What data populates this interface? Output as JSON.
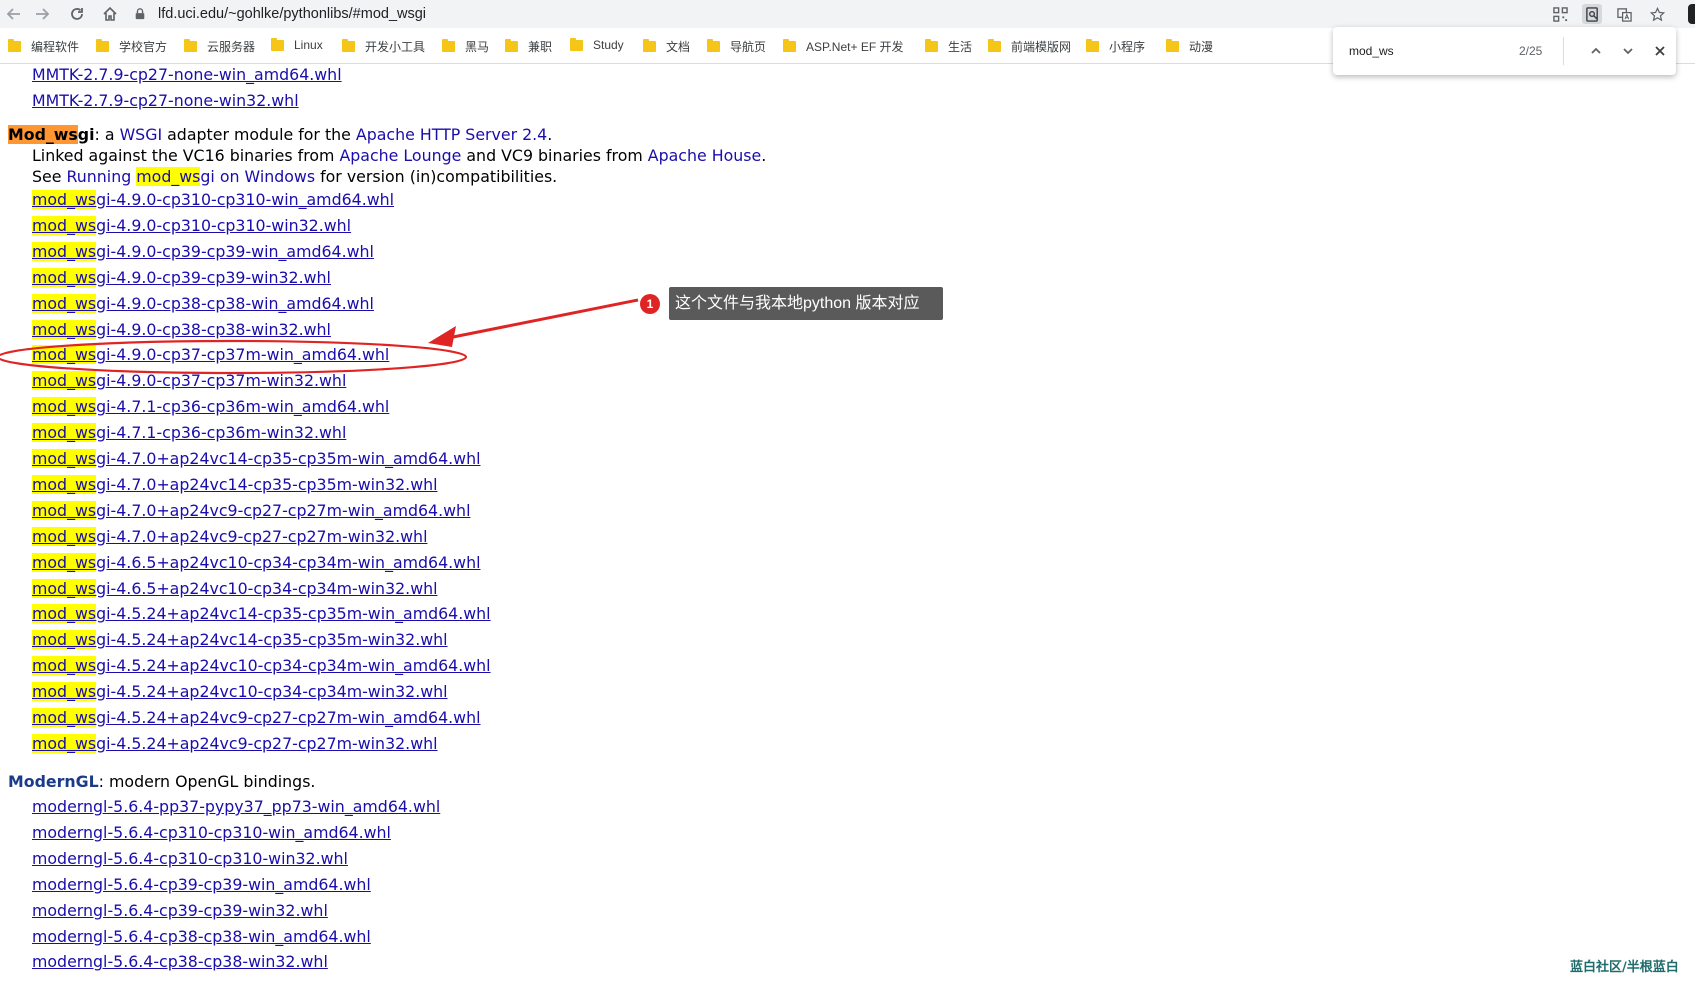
{
  "browser": {
    "url": "lfd.uci.edu/~gohlke/pythonlibs/#mod_wsgi",
    "bookmarks": [
      "编程软件",
      "学校官方",
      "云服务器",
      "Linux",
      "开发小工具",
      "黑马",
      "兼职",
      "Study",
      "文档",
      "导航页",
      "ASP.Net+ EF 开发",
      "生活",
      "前端模版网",
      "小程序",
      "动漫"
    ]
  },
  "find": {
    "query": "mod_ws",
    "count": "2/25"
  },
  "mmtk_links": [
    "MMTK-2.7.9-cp27-none-win_amd64.whl",
    "MMTK-2.7.9-cp27-none-win32.whl"
  ],
  "modwsgi": {
    "name_hl": "Mod_ws",
    "name_rest": "gi",
    "desc_a": ": a ",
    "desc_wsgi": "WSGI",
    "desc_b": " adapter module for the ",
    "desc_apache": "Apache HTTP Server 2.4",
    "desc_c": ".",
    "line2_a": "Linked against the VC16 binaries from ",
    "line2_lounge": "Apache Lounge",
    "line2_b": " and VC9 binaries from ",
    "line2_house": "Apache House",
    "line2_c": ".",
    "line3_a": "See ",
    "line3_running": "Running ",
    "line3_hl": "mod_ws",
    "line3_rest": "gi on Windows",
    "line3_b": " for version (in)compatibilities.",
    "hl_prefix": "mod_ws",
    "files": [
      "gi-4.9.0-cp310-cp310-win_amd64.whl",
      "gi-4.9.0-cp310-cp310-win32.whl",
      "gi-4.9.0-cp39-cp39-win_amd64.whl",
      "gi-4.9.0-cp39-cp39-win32.whl",
      "gi-4.9.0-cp38-cp38-win_amd64.whl",
      "gi-4.9.0-cp38-cp38-win32.whl",
      "gi-4.9.0-cp37-cp37m-win_amd64.whl",
      "gi-4.9.0-cp37-cp37m-win32.whl",
      "gi-4.7.1-cp36-cp36m-win_amd64.whl",
      "gi-4.7.1-cp36-cp36m-win32.whl",
      "gi-4.7.0+ap24vc14-cp35-cp35m-win_amd64.whl",
      "gi-4.7.0+ap24vc14-cp35-cp35m-win32.whl",
      "gi-4.7.0+ap24vc9-cp27-cp27m-win_amd64.whl",
      "gi-4.7.0+ap24vc9-cp27-cp27m-win32.whl",
      "gi-4.6.5+ap24vc10-cp34-cp34m-win_amd64.whl",
      "gi-4.6.5+ap24vc10-cp34-cp34m-win32.whl",
      "gi-4.5.24+ap24vc14-cp35-cp35m-win_amd64.whl",
      "gi-4.5.24+ap24vc14-cp35-cp35m-win32.whl",
      "gi-4.5.24+ap24vc10-cp34-cp34m-win_amd64.whl",
      "gi-4.5.24+ap24vc10-cp34-cp34m-win32.whl",
      "gi-4.5.24+ap24vc9-cp27-cp27m-win_amd64.whl",
      "gi-4.5.24+ap24vc9-cp27-cp27m-win32.whl"
    ]
  },
  "moderngl": {
    "name": "ModernGL",
    "desc": ": modern OpenGL bindings.",
    "files": [
      "moderngl-5.6.4-pp37-pypy37_pp73-win_amd64.whl",
      "moderngl-5.6.4-cp310-cp310-win_amd64.whl",
      "moderngl-5.6.4-cp310-cp310-win32.whl",
      "moderngl-5.6.4-cp39-cp39-win_amd64.whl",
      "moderngl-5.6.4-cp39-cp39-win32.whl",
      "moderngl-5.6.4-cp38-cp38-win_amd64.whl",
      "moderngl-5.6.4-cp38-cp38-win32.whl"
    ]
  },
  "annotation": {
    "badge": "1",
    "text": "这个文件与我本地python 版本对应",
    "circled_index": 6
  },
  "watermark": "蓝白社区/半根蓝白"
}
